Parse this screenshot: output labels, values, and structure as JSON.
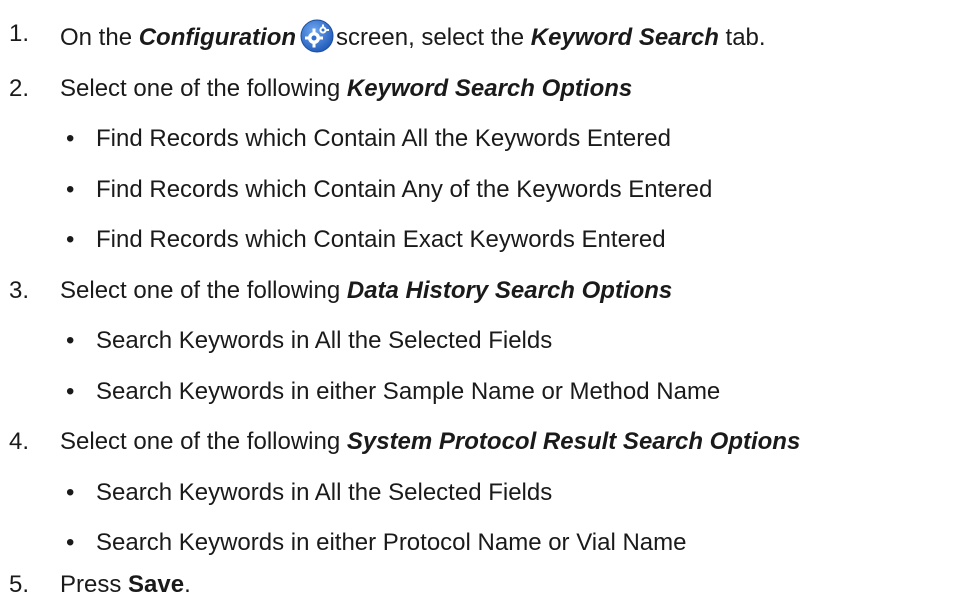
{
  "steps": [
    {
      "number": "1.",
      "parts": [
        "On the ",
        "Configuration",
        "screen, select the ",
        "Keyword Search",
        " tab."
      ]
    },
    {
      "number": "2.",
      "parts": [
        "Select one of the following ",
        "Keyword Search Options"
      ],
      "bullets": [
        "Find Records which Contain All the Keywords Entered",
        "Find Records which Contain Any of the Keywords Entered",
        "Find Records which Contain Exact Keywords Entered"
      ]
    },
    {
      "number": "3.",
      "parts": [
        "Select one of the following ",
        "Data History Search Options"
      ],
      "bullets": [
        "Search Keywords in All the Selected Fields",
        "Search Keywords in either Sample Name or Method Name"
      ]
    },
    {
      "number": "4.",
      "parts": [
        "Select one of the following ",
        "System Protocol Result Search Options"
      ],
      "bullets": [
        "Search Keywords in All the Selected Fields",
        "Search Keywords in either Protocol Name or Vial Name"
      ]
    },
    {
      "number": "5.",
      "parts": [
        "Press ",
        "Save",
        "."
      ]
    }
  ],
  "bullet_glyph": "•",
  "icons": {
    "configuration": "gear-icon"
  },
  "colors": {
    "gear_blue": "#2f6fd0",
    "text": "#1a1a1a"
  }
}
